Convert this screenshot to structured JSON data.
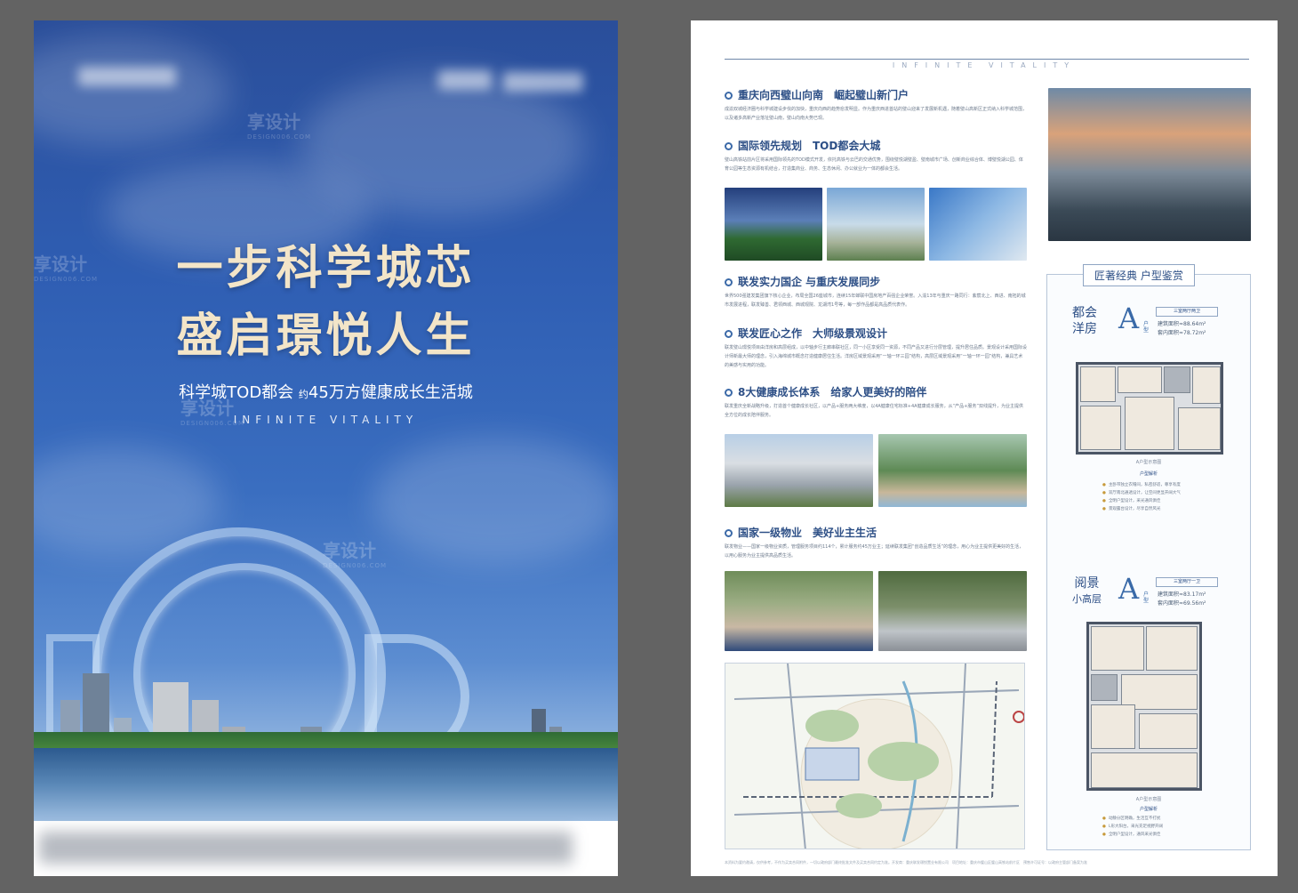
{
  "left_poster": {
    "headline_line1": "一步科学城芯",
    "headline_line2": "盛启璟悦人生",
    "subline_prefix": "科学城TOD都会",
    "subline_mid": "约",
    "subline_suffix": "45万方健康成长生活城",
    "tagline_en": "INFINITE VITALITY",
    "watermark": "享设计",
    "watermark_sub": "DESIGN006.COM"
  },
  "right_poster": {
    "tagline_en": "INFINITE VITALITY",
    "sections": [
      {
        "title": "重庆向西璧山向南　崛起璧山新门户",
        "body": "成渝双城经济圈与科学城建设步伐的加快，重庆向西的趋势愈发明显。作为重庆西进首站的璧山迎来了发展新机遇，随着璧山高新区正式纳入科学城范围，以及诸多高新产业落址璧山南，璧山向南大势已现。"
      },
      {
        "title": "国际领先规划　TOD都会大城",
        "body": "璧山高铁站前片区将采用国际领先的TOD模式开发，依托高铁与云巴的交通优势，围绕璧悦湖璧盈、璧南城市广场、创新商业综合体、博璧悦湖公园、体育公园等生态资源有机结合，打造集商业、商务、生态休闲、办公就业为一体的都会生活。"
      },
      {
        "title": "联发实力国企 与重庆发展同步",
        "body": "世界500强建发集团旗下核心企业，布局全国26座城市，连续15年蝉联中国房地产百强企业荣誉。入渝13年与重庆一路同行：紫宸北上、西进、南拓的城市发展进程，联发臻善、君领西城、西城观院、龙湖湾1号等，每一部作品都是高品质代表作。"
      },
      {
        "title": "联发匠心之作　大师级景观设计",
        "body": "联发璧山璟悦项目由洋房和高层组成，以中轴步行主廊串联社区，同一小区享受同一资源，不同产品又进行分层管理，提升居住品质。景观设计采用国际设计师新最大师的理念，引入海绵城市概念打造健康居住生活。洋房区域景观采用“一轴一环三园”结构，高层区域景观采用“一轴一环一园”结构，兼具艺术的美感与实用的功能。"
      },
      {
        "title": "8大健康成长体系　给家人更美好的陪伴",
        "body": "联发重庆全新战略升级，打造首个健康成长社区，以产品+服务两大维度，以4A健康住宅标准+4A健康成长服务，从“产品+服务”双线提升，为业主提供全方位的成长陪伴服务。"
      },
      {
        "title": "国家一级物业　美好业主生活",
        "body": "联发物业——国家一级物业资质，管理服务项目约114个，累计服务约45万业主；延续联发集团“创造品质生活”的理念，用心为业主提供更美好的生活，以用心服务为业主提供高品质生活。"
      }
    ],
    "fine_print": "本资料为要约邀请，仅供参考，不作为买卖合同附件，一切以政府部门最终批准文件及买卖合同约定为准。开发商：重庆联发璟悦置业有限公司　项目地址：重庆市璧山区璧山高铁站前片区　预售许可证号：以政府主管部门备案为准",
    "plan_panel": {
      "title": "匠著经典 户型鉴赏",
      "plans": [
        {
          "name_line1": "都会",
          "name_line2": "洋房",
          "letter": "A",
          "type_label": "户型",
          "layout": "三室两厅两卫",
          "area_build": "建筑面积≈88.64m²",
          "area_inner": "套内面积≈78.72m²",
          "caption": "A户型示意图",
          "analysis_title": "户型解析",
          "analysis": [
            "主卧带独立衣帽间，私密舒适，尊享有度",
            "双厅南北通透设计，让空间更显开阔大气",
            "全明户型设计，采光通风俱佳",
            "景观露台设计，尽享自然风光"
          ]
        },
        {
          "name_line1": "阅景",
          "name_line2": "小高层",
          "letter": "A",
          "type_label": "户型",
          "layout": "三室两厅一卫",
          "area_build": "建筑面积≈83.17m²",
          "area_inner": "套内面积≈69.56m²",
          "caption": "A户型示意图",
          "analysis_title": "户型解析",
          "analysis": [
            "动静分区明确，生活互不打扰",
            "L形大阳台，采光充足视野开阔",
            "全明户型设计，通风采光俱佳"
          ]
        }
      ]
    }
  }
}
